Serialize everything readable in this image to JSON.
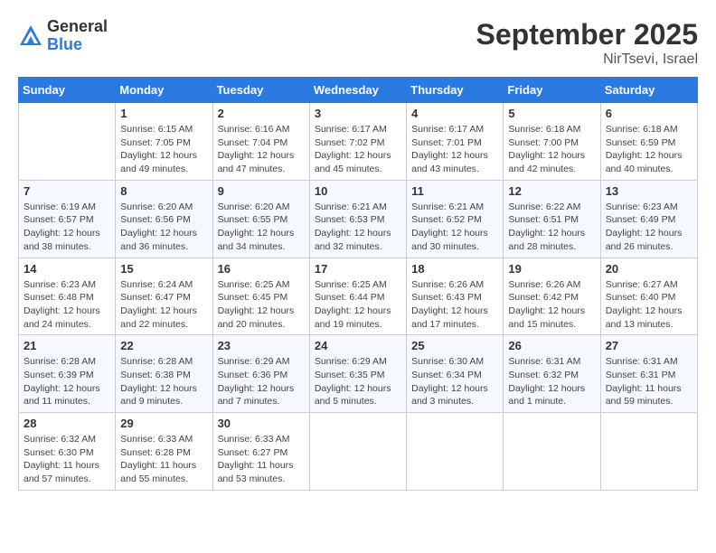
{
  "header": {
    "logo_general": "General",
    "logo_blue": "Blue",
    "month_title": "September 2025",
    "location": "NirTsevi, Israel"
  },
  "columns": [
    "Sunday",
    "Monday",
    "Tuesday",
    "Wednesday",
    "Thursday",
    "Friday",
    "Saturday"
  ],
  "weeks": [
    [
      {
        "day": "",
        "sunrise": "",
        "sunset": "",
        "daylight": ""
      },
      {
        "day": "1",
        "sunrise": "Sunrise: 6:15 AM",
        "sunset": "Sunset: 7:05 PM",
        "daylight": "Daylight: 12 hours and 49 minutes."
      },
      {
        "day": "2",
        "sunrise": "Sunrise: 6:16 AM",
        "sunset": "Sunset: 7:04 PM",
        "daylight": "Daylight: 12 hours and 47 minutes."
      },
      {
        "day": "3",
        "sunrise": "Sunrise: 6:17 AM",
        "sunset": "Sunset: 7:02 PM",
        "daylight": "Daylight: 12 hours and 45 minutes."
      },
      {
        "day": "4",
        "sunrise": "Sunrise: 6:17 AM",
        "sunset": "Sunset: 7:01 PM",
        "daylight": "Daylight: 12 hours and 43 minutes."
      },
      {
        "day": "5",
        "sunrise": "Sunrise: 6:18 AM",
        "sunset": "Sunset: 7:00 PM",
        "daylight": "Daylight: 12 hours and 42 minutes."
      },
      {
        "day": "6",
        "sunrise": "Sunrise: 6:18 AM",
        "sunset": "Sunset: 6:59 PM",
        "daylight": "Daylight: 12 hours and 40 minutes."
      }
    ],
    [
      {
        "day": "7",
        "sunrise": "Sunrise: 6:19 AM",
        "sunset": "Sunset: 6:57 PM",
        "daylight": "Daylight: 12 hours and 38 minutes."
      },
      {
        "day": "8",
        "sunrise": "Sunrise: 6:20 AM",
        "sunset": "Sunset: 6:56 PM",
        "daylight": "Daylight: 12 hours and 36 minutes."
      },
      {
        "day": "9",
        "sunrise": "Sunrise: 6:20 AM",
        "sunset": "Sunset: 6:55 PM",
        "daylight": "Daylight: 12 hours and 34 minutes."
      },
      {
        "day": "10",
        "sunrise": "Sunrise: 6:21 AM",
        "sunset": "Sunset: 6:53 PM",
        "daylight": "Daylight: 12 hours and 32 minutes."
      },
      {
        "day": "11",
        "sunrise": "Sunrise: 6:21 AM",
        "sunset": "Sunset: 6:52 PM",
        "daylight": "Daylight: 12 hours and 30 minutes."
      },
      {
        "day": "12",
        "sunrise": "Sunrise: 6:22 AM",
        "sunset": "Sunset: 6:51 PM",
        "daylight": "Daylight: 12 hours and 28 minutes."
      },
      {
        "day": "13",
        "sunrise": "Sunrise: 6:23 AM",
        "sunset": "Sunset: 6:49 PM",
        "daylight": "Daylight: 12 hours and 26 minutes."
      }
    ],
    [
      {
        "day": "14",
        "sunrise": "Sunrise: 6:23 AM",
        "sunset": "Sunset: 6:48 PM",
        "daylight": "Daylight: 12 hours and 24 minutes."
      },
      {
        "day": "15",
        "sunrise": "Sunrise: 6:24 AM",
        "sunset": "Sunset: 6:47 PM",
        "daylight": "Daylight: 12 hours and 22 minutes."
      },
      {
        "day": "16",
        "sunrise": "Sunrise: 6:25 AM",
        "sunset": "Sunset: 6:45 PM",
        "daylight": "Daylight: 12 hours and 20 minutes."
      },
      {
        "day": "17",
        "sunrise": "Sunrise: 6:25 AM",
        "sunset": "Sunset: 6:44 PM",
        "daylight": "Daylight: 12 hours and 19 minutes."
      },
      {
        "day": "18",
        "sunrise": "Sunrise: 6:26 AM",
        "sunset": "Sunset: 6:43 PM",
        "daylight": "Daylight: 12 hours and 17 minutes."
      },
      {
        "day": "19",
        "sunrise": "Sunrise: 6:26 AM",
        "sunset": "Sunset: 6:42 PM",
        "daylight": "Daylight: 12 hours and 15 minutes."
      },
      {
        "day": "20",
        "sunrise": "Sunrise: 6:27 AM",
        "sunset": "Sunset: 6:40 PM",
        "daylight": "Daylight: 12 hours and 13 minutes."
      }
    ],
    [
      {
        "day": "21",
        "sunrise": "Sunrise: 6:28 AM",
        "sunset": "Sunset: 6:39 PM",
        "daylight": "Daylight: 12 hours and 11 minutes."
      },
      {
        "day": "22",
        "sunrise": "Sunrise: 6:28 AM",
        "sunset": "Sunset: 6:38 PM",
        "daylight": "Daylight: 12 hours and 9 minutes."
      },
      {
        "day": "23",
        "sunrise": "Sunrise: 6:29 AM",
        "sunset": "Sunset: 6:36 PM",
        "daylight": "Daylight: 12 hours and 7 minutes."
      },
      {
        "day": "24",
        "sunrise": "Sunrise: 6:29 AM",
        "sunset": "Sunset: 6:35 PM",
        "daylight": "Daylight: 12 hours and 5 minutes."
      },
      {
        "day": "25",
        "sunrise": "Sunrise: 6:30 AM",
        "sunset": "Sunset: 6:34 PM",
        "daylight": "Daylight: 12 hours and 3 minutes."
      },
      {
        "day": "26",
        "sunrise": "Sunrise: 6:31 AM",
        "sunset": "Sunset: 6:32 PM",
        "daylight": "Daylight: 12 hours and 1 minute."
      },
      {
        "day": "27",
        "sunrise": "Sunrise: 6:31 AM",
        "sunset": "Sunset: 6:31 PM",
        "daylight": "Daylight: 11 hours and 59 minutes."
      }
    ],
    [
      {
        "day": "28",
        "sunrise": "Sunrise: 6:32 AM",
        "sunset": "Sunset: 6:30 PM",
        "daylight": "Daylight: 11 hours and 57 minutes."
      },
      {
        "day": "29",
        "sunrise": "Sunrise: 6:33 AM",
        "sunset": "Sunset: 6:28 PM",
        "daylight": "Daylight: 11 hours and 55 minutes."
      },
      {
        "day": "30",
        "sunrise": "Sunrise: 6:33 AM",
        "sunset": "Sunset: 6:27 PM",
        "daylight": "Daylight: 11 hours and 53 minutes."
      },
      {
        "day": "",
        "sunrise": "",
        "sunset": "",
        "daylight": ""
      },
      {
        "day": "",
        "sunrise": "",
        "sunset": "",
        "daylight": ""
      },
      {
        "day": "",
        "sunrise": "",
        "sunset": "",
        "daylight": ""
      },
      {
        "day": "",
        "sunrise": "",
        "sunset": "",
        "daylight": ""
      }
    ]
  ]
}
